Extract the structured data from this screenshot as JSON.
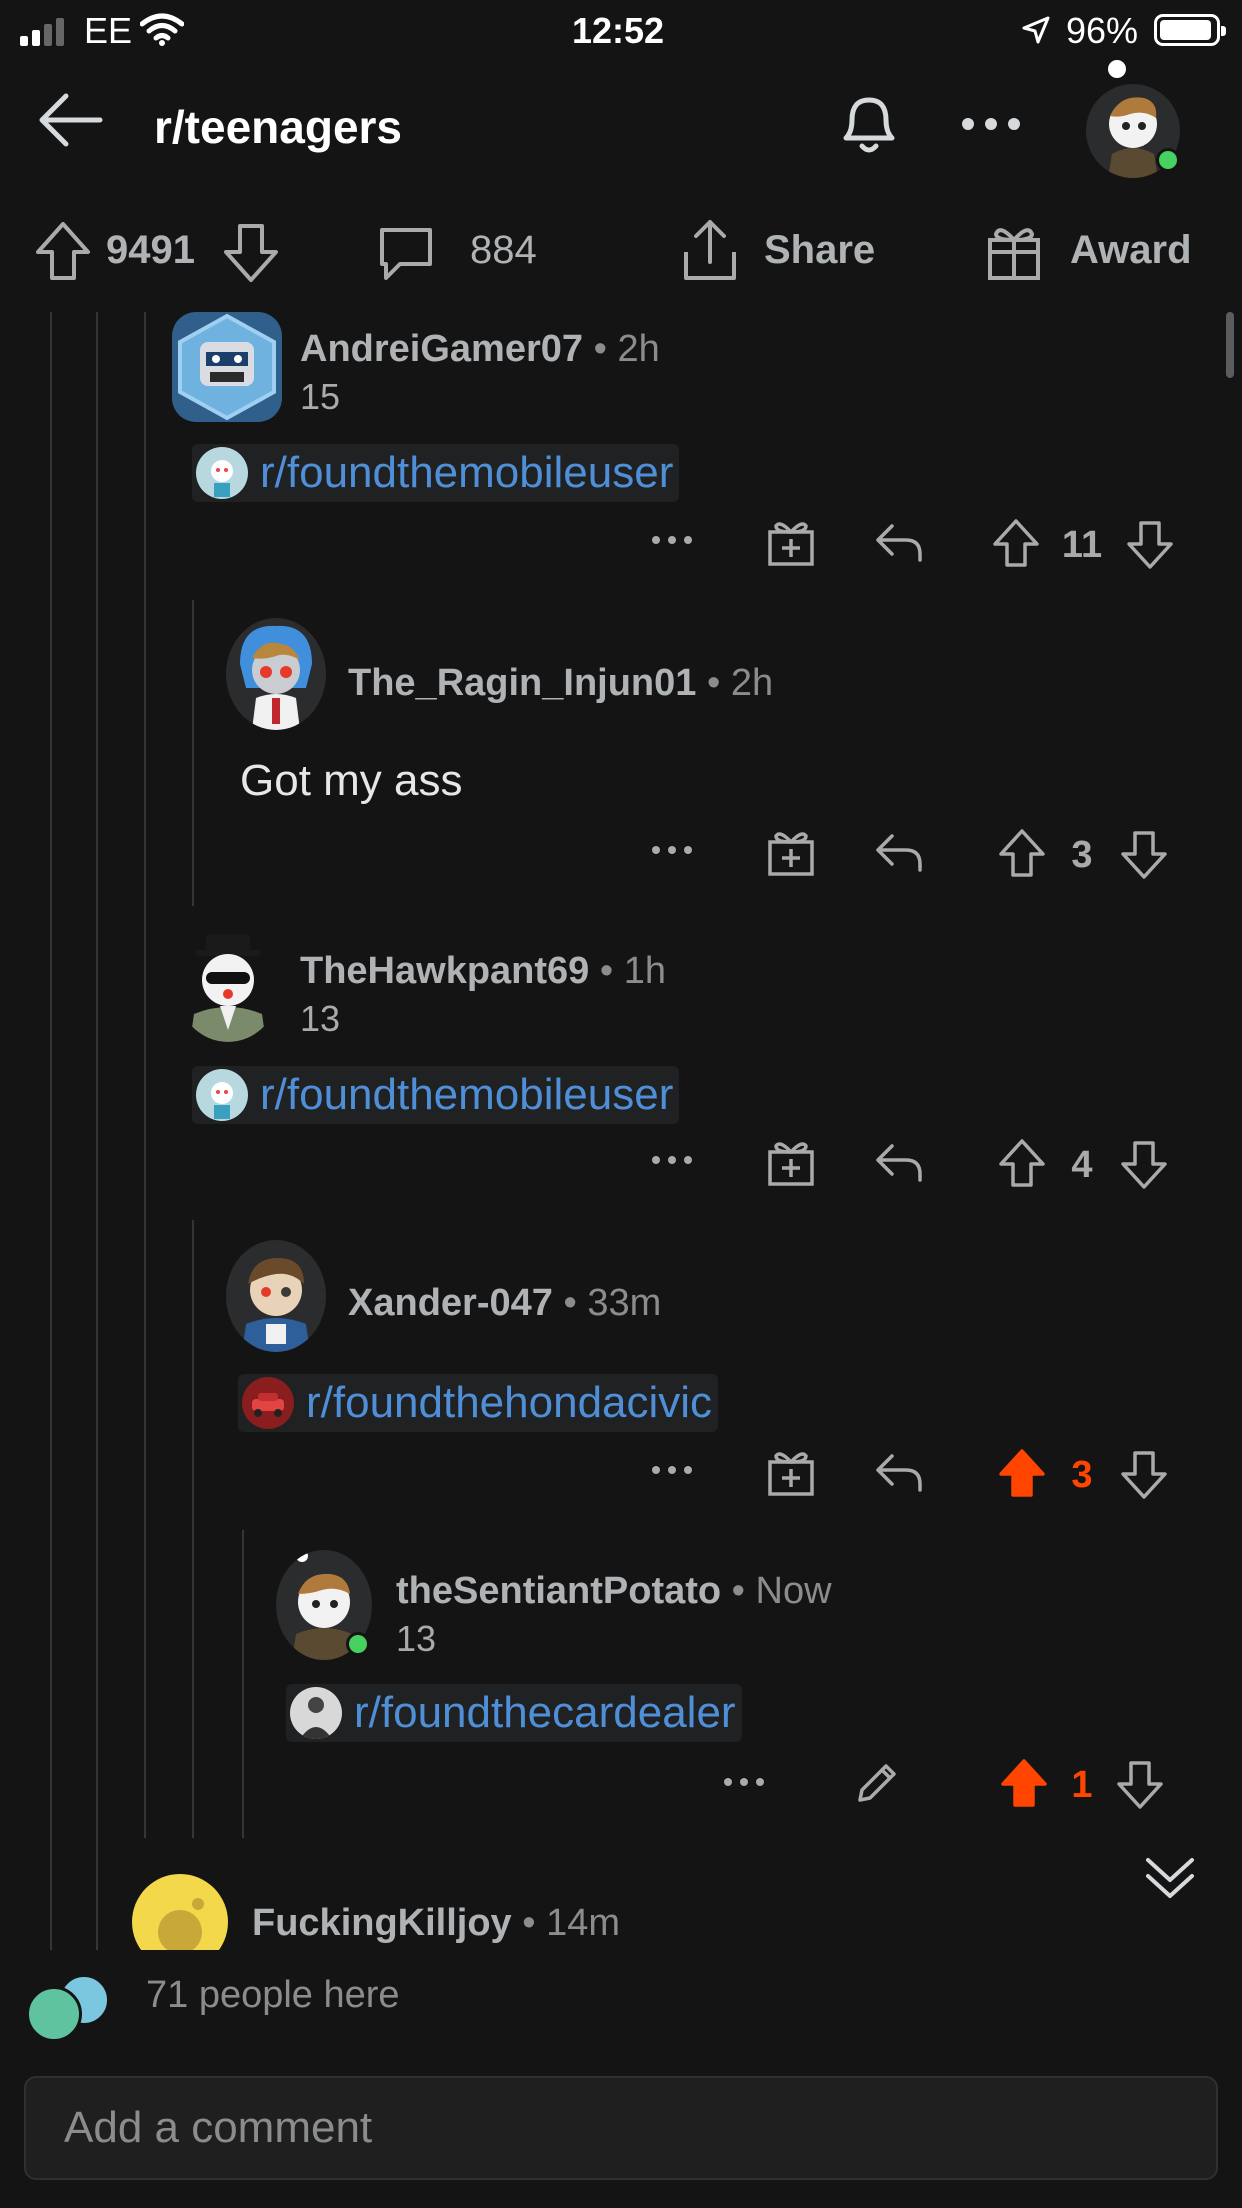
{
  "status_bar": {
    "carrier": "EE",
    "time": "12:52",
    "battery": "96%"
  },
  "header": {
    "subreddit": "r/teenagers"
  },
  "post_actions": {
    "upvotes": "9491",
    "comments": "884",
    "share_label": "Share",
    "award_label": "Award"
  },
  "colors": {
    "upvoted": "#ff4500",
    "link": "#4f8fd8",
    "online": "#46d160",
    "background": "#141414"
  },
  "comments": [
    {
      "username": "AndreiGamer07",
      "time": "2h",
      "flair": "15",
      "link": "r/foundthemobileuser",
      "votes": "11",
      "upvoted": false
    },
    {
      "username": "The_Ragin_Injun01",
      "time": "2h",
      "body": "Got my ass",
      "votes": "3",
      "upvoted": false
    },
    {
      "username": "TheHawkpant69",
      "time": "1h",
      "flair": "13",
      "link": "r/foundthemobileuser",
      "votes": "4",
      "upvoted": false
    },
    {
      "username": "Xander-047",
      "time": "33m",
      "link": "r/foundthehondacivic",
      "votes": "3",
      "upvoted": true
    },
    {
      "username": "theSentiantPotato",
      "time": "Now",
      "flair": "13",
      "link": "r/foundthecardealer",
      "votes": "1",
      "upvoted": true
    },
    {
      "username": "FuckingKilljoy",
      "time": "14m"
    }
  ],
  "presence": {
    "text": "71 people here"
  },
  "composer": {
    "placeholder": "Add a comment"
  }
}
